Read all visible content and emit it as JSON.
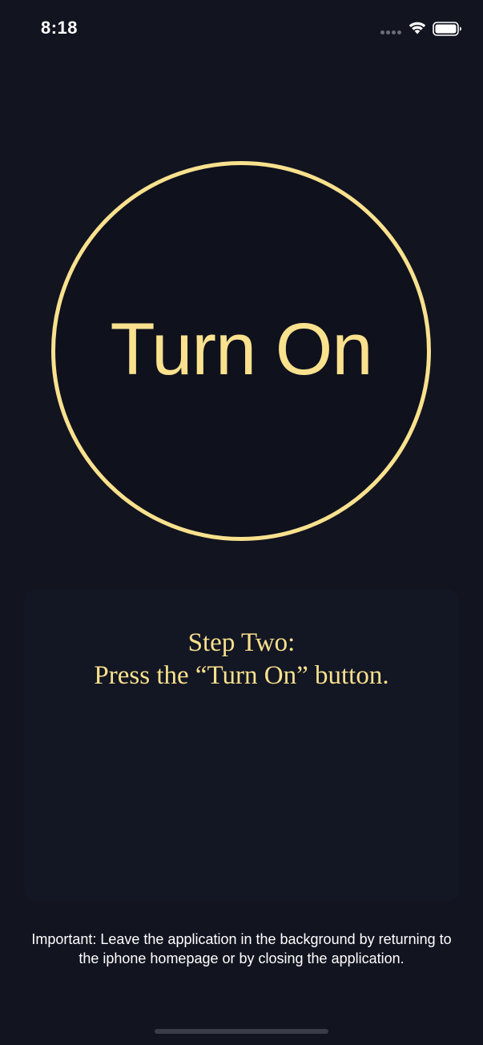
{
  "status_bar": {
    "time": "8:18"
  },
  "dial": {
    "label": "Turn On"
  },
  "instructions": {
    "step_title": "Step Two:",
    "step_body": "Press the “Turn On” button."
  },
  "footer": {
    "important_note": "Important: Leave the application in the background by returning to the iphone homepage or by closing the application."
  },
  "colors": {
    "background": "#121420",
    "accent": "#f9e18e",
    "text": "#ffffff"
  },
  "icons": [
    "signal-dots-icon",
    "wifi-icon",
    "battery-icon"
  ]
}
